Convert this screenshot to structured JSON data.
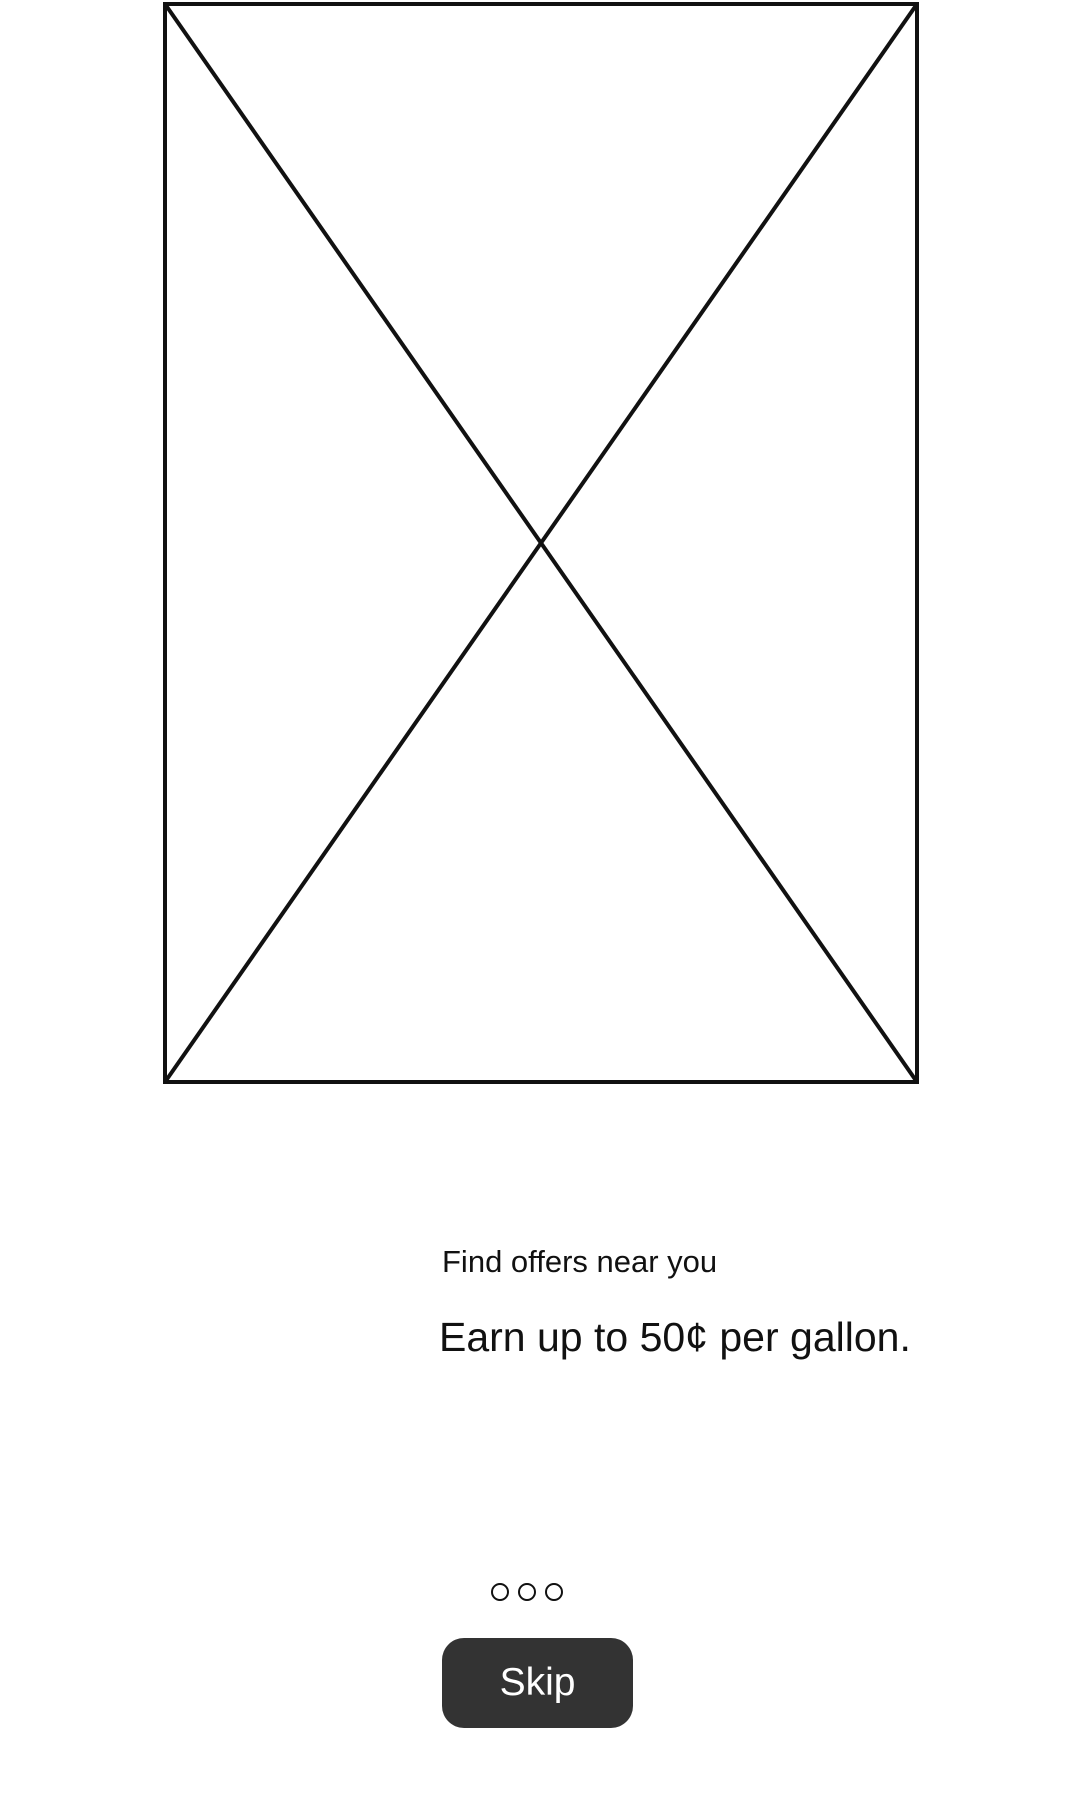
{
  "onboarding": {
    "subtitle": "Find offers near you",
    "headline": "Earn up to 50¢ per gallon.",
    "pager": {
      "total_pages": 3
    },
    "skip_label": "Skip"
  },
  "colors": {
    "button_background": "#333333",
    "button_text": "#ffffff",
    "text": "#111111",
    "placeholder_stroke": "#111111"
  }
}
